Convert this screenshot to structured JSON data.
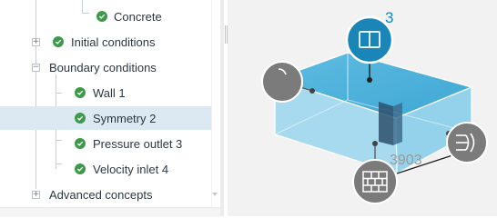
{
  "tree": {
    "items": [
      {
        "label": "Concrete",
        "level": 2,
        "expander": null,
        "checked": true,
        "selected": false
      },
      {
        "label": "Initial conditions",
        "level": 0,
        "expander": "+",
        "checked": true,
        "selected": false
      },
      {
        "label": "Boundary conditions",
        "level": 0,
        "expander": "−",
        "checked": false,
        "selected": false
      },
      {
        "label": "Wall 1",
        "level": 1,
        "expander": null,
        "checked": true,
        "selected": false
      },
      {
        "label": "Symmetry 2",
        "level": 1,
        "expander": null,
        "checked": true,
        "selected": true
      },
      {
        "label": "Pressure outlet 3",
        "level": 1,
        "expander": null,
        "checked": true,
        "selected": false
      },
      {
        "label": "Velocity inlet 4",
        "level": 1,
        "expander": null,
        "checked": true,
        "selected": false
      },
      {
        "label": "Advanced concepts",
        "level": 0,
        "expander": "+",
        "checked": false,
        "selected": false
      }
    ]
  },
  "viewport": {
    "selected_count": "3",
    "dimension_label": "3903",
    "icons": {
      "symmetry": "symmetry-plane-icon",
      "wall": "brick-wall-icon",
      "inlet": "velocity-inlet-icon",
      "outlet": "pressure-outlet-icon"
    }
  },
  "colors": {
    "check_green": "#3d9a4a",
    "selected_row": "#dde9f2",
    "highlight_blue": "#1a86b8",
    "box_fill": "#5ec2e6",
    "marker_gray": "#7b7b7b"
  }
}
